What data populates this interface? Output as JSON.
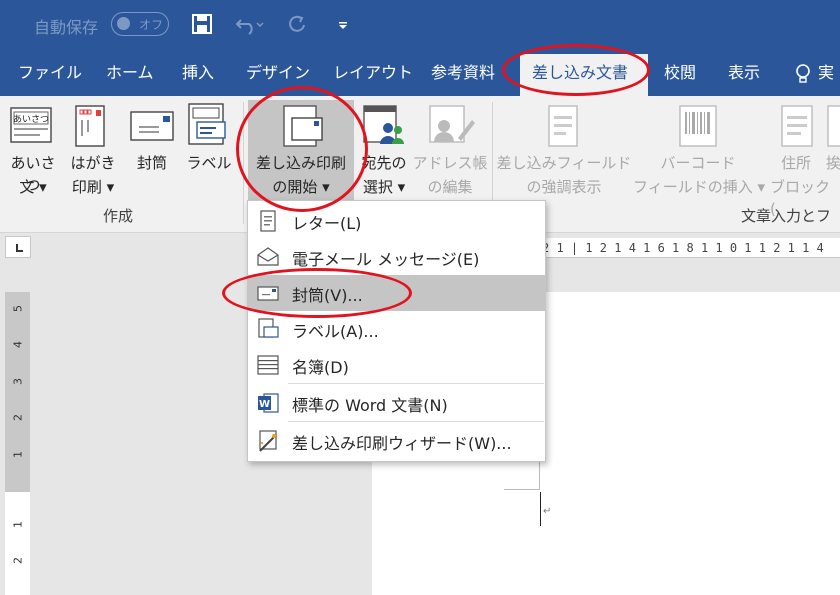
{
  "titlebar": {
    "autosave_label": "自動保存",
    "toggle_state": "オフ",
    "qat_icons": [
      "save-icon",
      "undo-icon",
      "redo-icon",
      "customize-qat-icon"
    ]
  },
  "tabs": [
    {
      "label": "ファイル"
    },
    {
      "label": "ホーム"
    },
    {
      "label": "挿入"
    },
    {
      "label": "デザイン"
    },
    {
      "label": "レイアウト"
    },
    {
      "label": "参考資料"
    },
    {
      "label": "差し込み文書",
      "active": true
    },
    {
      "label": "校閲"
    },
    {
      "label": "表示"
    },
    {
      "label": "実"
    }
  ],
  "ribbon": {
    "create_group": {
      "label": "作成",
      "buttons": [
        {
          "line1": "あいさつ",
          "line2": "文 ▾",
          "icon": "greeting-letter-icon",
          "icon_text": "あいさつ"
        },
        {
          "line1": "はがき",
          "line2": "印刷 ▾",
          "icon": "postcard-icon"
        },
        {
          "line1": "封筒",
          "line2": "",
          "icon": "envelope-icon"
        },
        {
          "line1": "ラベル",
          "line2": "",
          "icon": "labels-icon"
        }
      ]
    },
    "start_group": {
      "buttons": [
        {
          "line1": "差し込み印刷",
          "line2": "の開始 ▾",
          "icon": "start-mail-merge-icon"
        },
        {
          "line1": "宛先の",
          "line2": "選択 ▾",
          "icon": "select-recipients-icon"
        },
        {
          "line1": "アドレス帳",
          "line2": "の編集",
          "icon": "edit-recipients-icon",
          "disabled": true
        }
      ]
    },
    "write_insert_group": {
      "label": "文章入力とフィ",
      "buttons": [
        {
          "line1": "差し込みフィールド",
          "line2": "の強調表示",
          "icon": "highlight-fields-icon",
          "disabled": true
        },
        {
          "line1": "バーコード",
          "line2": "フィールドの挿入 ▾",
          "icon": "barcode-icon",
          "disabled": true
        },
        {
          "line1": "住所",
          "line2": "ブロック (",
          "icon": "address-block-icon",
          "disabled": true
        },
        {
          "line1": "挨",
          "line2": "",
          "icon": "greeting-line-icon",
          "disabled": true
        }
      ]
    }
  },
  "ruler": {
    "horizontal": "2 1 | 1 2 1 4 1 6 1 8 1 1 0 1 1 2 1 1 4",
    "vertical_numbers": [
      "5",
      "4",
      "3",
      "2",
      "1",
      "1",
      "2"
    ]
  },
  "dropdown_menu": {
    "items": [
      {
        "label": "レター(L)",
        "icon": "letter-icon"
      },
      {
        "label": "電子メール メッセージ(E)",
        "icon": "email-icon"
      },
      {
        "label": "封筒(V)...",
        "icon": "envelope-icon",
        "highlighted": true
      },
      {
        "label": "ラベル(A)...",
        "icon": "labels-icon"
      },
      {
        "label": "名簿(D)",
        "icon": "directory-icon"
      },
      {
        "label": "標準の Word 文書(N)",
        "icon": "word-document-icon"
      },
      {
        "label": "差し込み印刷ウィザード(W)...",
        "icon": "mail-merge-wizard-icon"
      }
    ]
  },
  "colors": {
    "brand": "#2b579a",
    "annotation": "#e0141e",
    "highlight": "#c5c5c5"
  }
}
